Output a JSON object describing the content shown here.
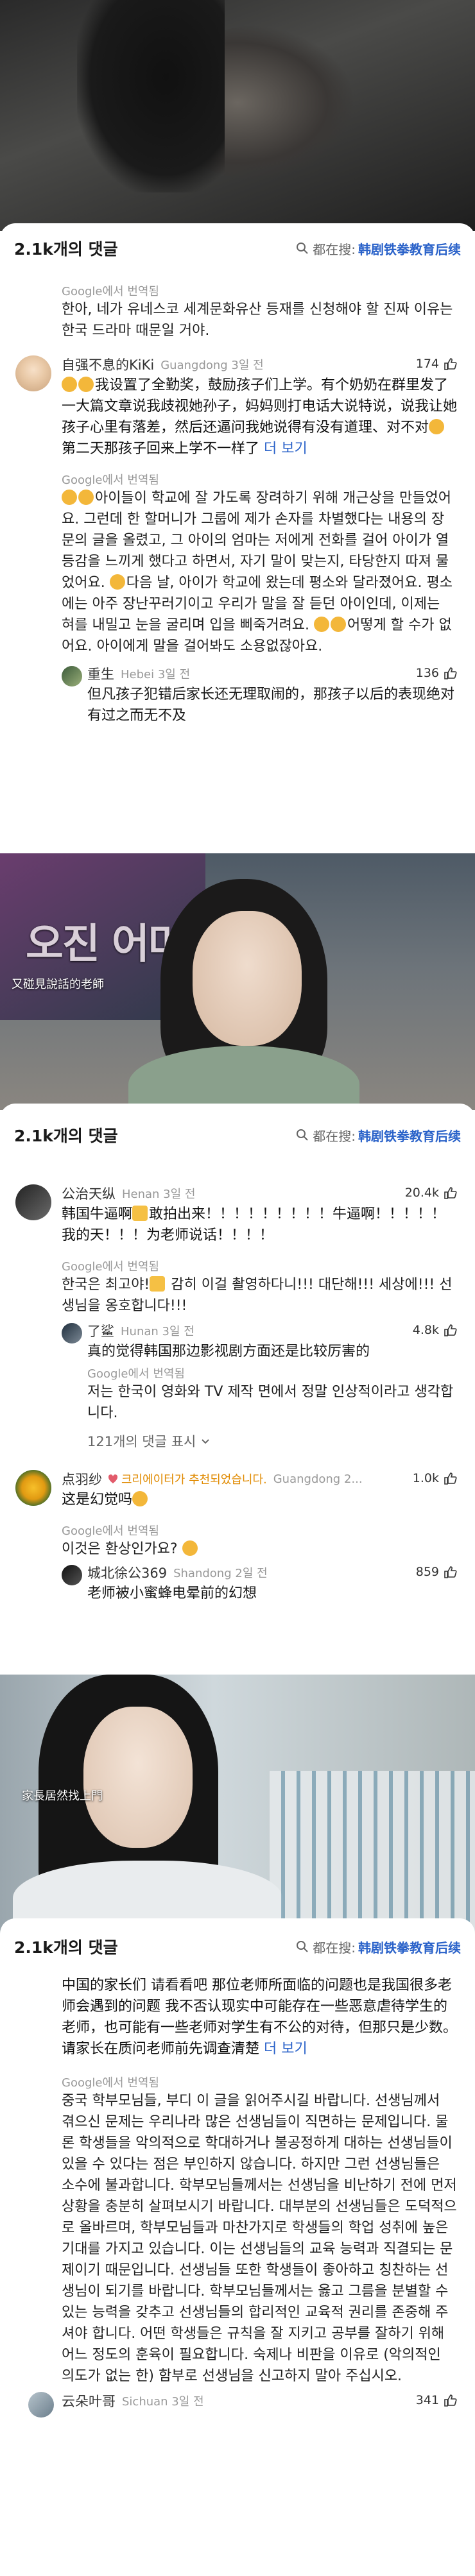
{
  "panel1": {
    "header": {
      "title": "2.1k개의 댓글",
      "search_prefix": "都在搜:",
      "search_keyword": "韩剧铁拳教育后续"
    },
    "top_translation": {
      "source": "Google에서 번역됨",
      "text": "한아, 네가 유네스코 세계문화유산 등재를 신청해야 할 진짜 이유는 한국 드라마 때문일 거야."
    },
    "comment": {
      "username": "自强不息的KiKi",
      "location": "Guangdong 3일 전",
      "likes": "174",
      "text": "我设置了全勤奖，鼓励孩子们上学。有个奶奶在群里发了一大篇文章说我歧视她孙子，妈妈则打电话大说特说，说我让她孩子心里有落差，然后还逼问我她说得有没有道理、对不对",
      "text_tail": "第二天那孩子回来上学不一样了",
      "more": "더 보기",
      "tr_source": "Google에서 번역됨",
      "translation_a": "아이들이 학교에 잘 가도록 장려하기 위해 개근상을 만들었어요. 그런데 한 할머니가 그룹에 제가 손자를 차별했다는 내용의 장문의 글을 올렸고, 그 아이의 엄마는 저에게 전화를 걸어 아이가 열등감을 느끼게 했다고 하면서, 자기 말이 맞는지, 타당한지 따져 물었어요.",
      "translation_b": "다음 날, 아이가 학교에 왔는데 평소와 달라졌어요. 평소에는 아주 장난꾸러기이고 우리가 말을 잘 듣던 아이인데, 이제는 혀를 내밀고 눈을 굴리며 입을 삐죽거려요.",
      "translation_c": "어떻게 할 수가 없어요. 아이에게 말을 걸어봐도 소용없잖아요.",
      "reply": {
        "username": "重生",
        "location": "Hebei 3일 전",
        "likes": "136",
        "text": "但凡孩子犯错后家长还无理取闹的，那孩子以后的表现绝对有过之而无不及"
      }
    }
  },
  "video1": {
    "caption": "又碰見說話的老師",
    "watermark": "오진 어머"
  },
  "panel2": {
    "header": {
      "title": "2.1k개의 댓글",
      "search_prefix": "都在搜:",
      "search_keyword": "韩剧铁拳教育后续"
    },
    "comment1": {
      "username": "公治天纵",
      "location": "Henan 3일 전",
      "likes": "20.4k",
      "text_a": "韩国牛逼啊",
      "text_b": "敢拍出来！！！！！！！！！牛逼啊！！！！！我的天！！！为老师说话！！！！",
      "tr_source": "Google에서 번역됨",
      "translation_a": "한국은 최고야!",
      "translation_b": "감히 이걸 촬영하다니!!! 대단해!!! 세상에!!! 선생님을 옹호합니다!!!",
      "reply": {
        "username": "了鲨",
        "location": "Hunan 3일 전",
        "likes": "4.8k",
        "text": "真的觉得韩国那边影视剧方面还是比较厉害的",
        "tr_source": "Google에서 번역됨",
        "translation": "저는 한국이 영화와 TV 제작 면에서 정말 인상적이라고 생각합니다."
      },
      "toggle": "121개의 댓글 표시"
    },
    "comment2": {
      "username": "点羽纱",
      "badge": "크리에이터가 추천되었습니다.",
      "location": "Guangdong 2...",
      "likes": "1.0k",
      "text": "这是幻觉吗",
      "tr_source": "Google에서 번역됨",
      "translation": "이것은 환상인가요?",
      "reply": {
        "username": "城北徐公369",
        "location": "Shandong 2일 전",
        "likes": "859",
        "text": "老师被小蜜蜂电晕前的幻想"
      }
    }
  },
  "video2": {
    "caption": "家長居然找上門"
  },
  "panel3": {
    "header": {
      "title": "2.1k개의 댓글",
      "search_prefix": "都在搜:",
      "search_keyword": "韩剧铁拳教育后续"
    },
    "comment": {
      "text": "中国的家长们 请看看吧  那位老师所面临的问题也是我国很多老师会遇到的问题 我不否认现实中可能存在一些恶意虐待学生的老师，也可能有一些老师对学生有不公的对待，但那只是少数。请家长在质问老师前先调查清楚",
      "more": "더 보기",
      "tr_source": "Google에서 번역됨",
      "translation": "중국 학부모님들, 부디 이 글을 읽어주시길 바랍니다. 선생님께서 겪으신 문제는 우리나라 많은 선생님들이 직면하는 문제입니다. 물론 학생들을 악의적으로 학대하거나 불공정하게 대하는 선생님들이 있을 수 있다는 점은 부인하지 않습니다. 하지만 그런 선생님들은 소수에 불과합니다. 학부모님들께서는 선생님을 비난하기 전에 먼저 상황을 충분히 살펴보시기 바랍니다. 대부분의 선생님들은 도덕적으로 올바르며, 학부모님들과 마찬가지로 학생들의 학업 성취에 높은 기대를 가지고 있습니다. 이는 선생님들의 교육 능력과 직결되는 문제이기 때문입니다. 선생님들 또한 학생들이 좋아하고 칭찬하는 선생님이 되기를 바랍니다. 학부모님들께서는 옳고 그름을 분별할 수 있는 능력을 갖추고 선생님들의 합리적인 교육적 권리를 존중해 주셔야 합니다. 어떤 학생들은 규칙을 잘 지키고 공부를 잘하기 위해 어느 정도의 훈육이 필요합니다. 숙제나 비판을 이유로 (악의적인 의도가 없는 한) 함부로 선생님을 신고하지 말아 주십시오.",
      "next_username": "云朵叶哥",
      "next_location": "Sichuan 3일 전",
      "next_likes": "341"
    }
  }
}
